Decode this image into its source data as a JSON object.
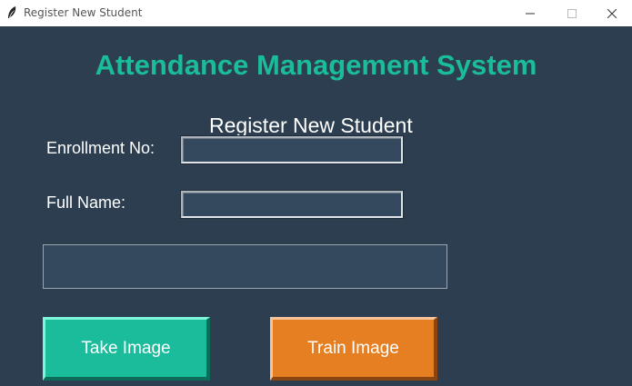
{
  "window": {
    "title": "Register New Student",
    "icon": "feather-icon"
  },
  "app": {
    "title": "Attendance Management System",
    "subtitle": "Register New Student"
  },
  "form": {
    "enrollment_label": "Enrollment No:",
    "enrollment_value": "",
    "name_label": "Full Name:",
    "name_value": "",
    "message": ""
  },
  "buttons": {
    "take_image": "Take Image",
    "train_image": "Train Image"
  },
  "colors": {
    "background": "#2c3e50",
    "accent": "#1abc9c",
    "field": "#34495e",
    "train": "#e67e22"
  }
}
